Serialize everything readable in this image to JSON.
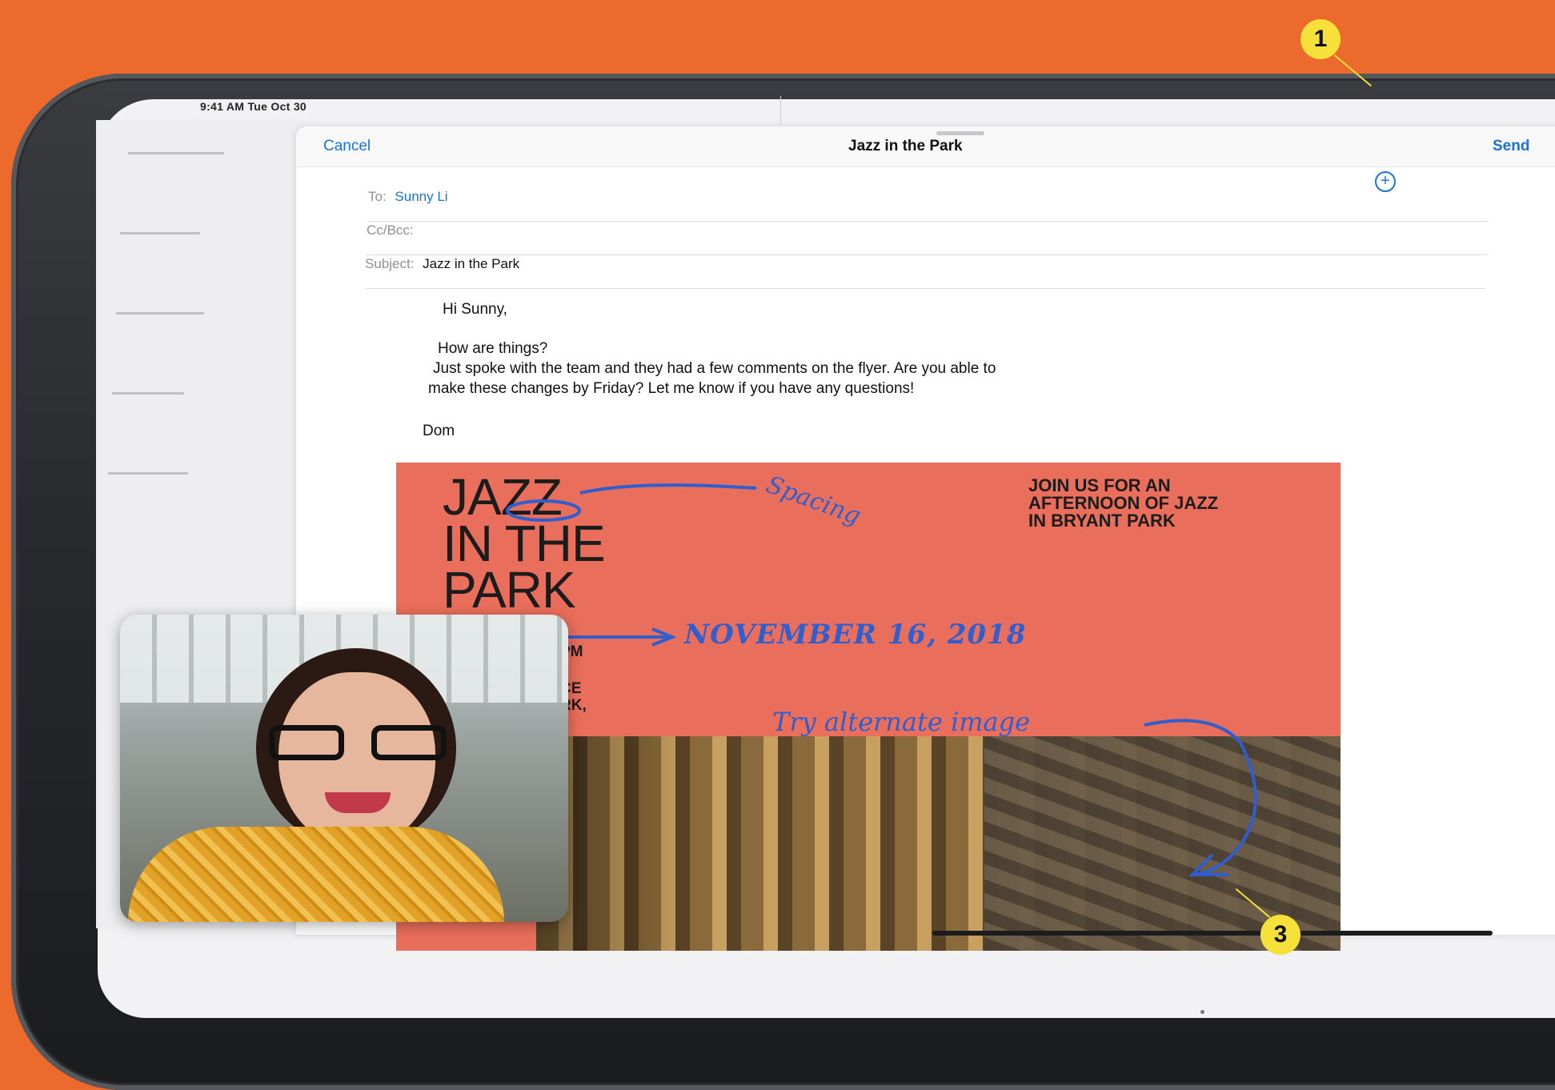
{
  "status": {
    "time_date": "9:41 AM  Tue Oct 30"
  },
  "compose": {
    "cancel_label": "Cancel",
    "title": "Jazz in the Park",
    "send_label": "Send",
    "to_label": "To:",
    "to_value": "Sunny Li",
    "ccbcc_label": "Cc/Bcc:",
    "subject_label": "Subject:",
    "subject_value": "Jazz in the Park",
    "greeting": "Hi Sunny,",
    "line1": "How are things?",
    "line2": "Just spoke with the team and they had a few comments on the flyer. Are you able to",
    "line3": "make these changes by Friday? Let me know if you have any questions!",
    "signature": "Dom"
  },
  "flyer": {
    "title": "JAZZ\nIN THE\nPARK",
    "tagline": "JOIN US FOR AN\nAFTERNOON OF JAZZ\nIN BRYANT PARK",
    "time_fragment": "PM",
    "place_fragment": "CE\nRK,"
  },
  "annotations": {
    "spacing": "Spacing",
    "date": "NOVEMBER 16, 2018",
    "alternate": "Try alternate image"
  },
  "callouts": {
    "one": "1",
    "three": "3"
  },
  "colors": {
    "background": "#ec6a2c",
    "accent": "#1a73d9",
    "flyer": "#ea6e5c",
    "ink": "#2f5fcf",
    "callout": "#f6e03a"
  }
}
